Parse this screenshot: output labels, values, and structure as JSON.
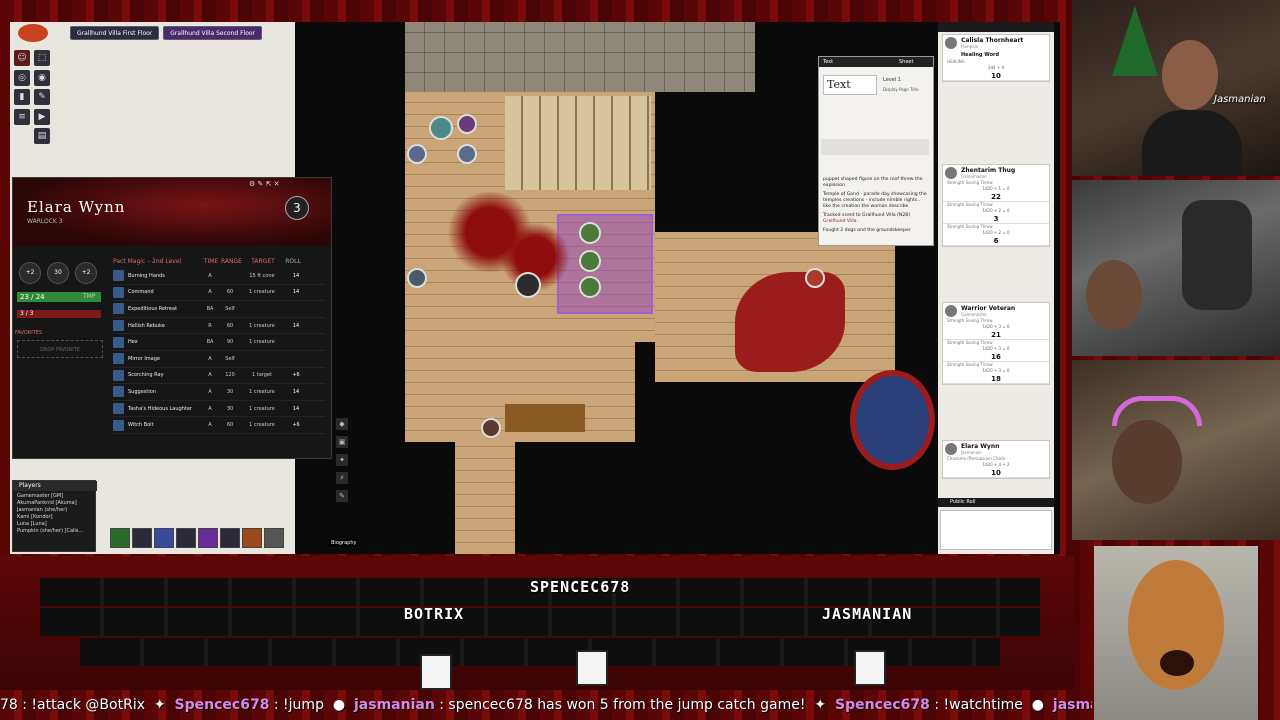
{
  "vtt": {
    "scene_tabs": [
      "Grallhund Villa First Floor",
      "Grallhund Villa Second Floor"
    ],
    "tools": [
      "token",
      "select",
      "measure",
      "light",
      "note",
      "draw",
      "list",
      "play",
      "journal"
    ]
  },
  "character": {
    "name": "Elara Wynn",
    "class": "WARLOCK 3",
    "level": "3",
    "hp": "23 / 24",
    "hp_tmp": "TMP",
    "spell_slots": "3 / 3",
    "favorites_label": "FAVORITES",
    "drop_favorite": "DROP FAVORITE",
    "stats": [
      "+2",
      "30",
      "+2"
    ],
    "spells_header": "Pact Magic – 2nd Level",
    "columns": [
      "TIME",
      "RANGE",
      "TARGET",
      "ROLL"
    ],
    "spells": [
      {
        "name": "Burning Hands",
        "time": "A",
        "range": "",
        "target": "15 ft cone",
        "roll": "14"
      },
      {
        "name": "Command",
        "time": "A",
        "range": "60",
        "target": "1 creature",
        "roll": "14"
      },
      {
        "name": "Expeditious Retreat",
        "time": "BA",
        "range": "Self",
        "target": "",
        "roll": ""
      },
      {
        "name": "Hellish Rebuke",
        "time": "R",
        "range": "60",
        "target": "1 creature",
        "roll": "14"
      },
      {
        "name": "Hex",
        "time": "BA",
        "range": "90",
        "target": "1 creature",
        "roll": ""
      },
      {
        "name": "Mirror Image",
        "time": "A",
        "range": "Self",
        "target": "",
        "roll": ""
      },
      {
        "name": "Scorching Ray",
        "time": "A",
        "range": "120",
        "target": "1 target",
        "roll": "+6"
      },
      {
        "name": "Suggestion",
        "time": "A",
        "range": "30",
        "target": "1 creature",
        "roll": "14"
      },
      {
        "name": "Tasha's Hideous Laughter",
        "time": "A",
        "range": "30",
        "target": "1 creature",
        "roll": "14"
      },
      {
        "name": "Witch Bolt",
        "time": "A",
        "range": "60",
        "target": "1 creature",
        "roll": "+6"
      }
    ],
    "tooltip": "Biography"
  },
  "players": {
    "title": "Players",
    "list": [
      "Gamemaster [GM]",
      "AkumaPanknid [Akuma]",
      "Jasmanian (she/her)",
      "Kami [Kondor]",
      "Luna [Luna]",
      "Pumpkin (she/her) [Calis..."
    ]
  },
  "journal": {
    "tab": "Text",
    "sheet_btn": "Sheet",
    "name": "Text",
    "level": "Level 1",
    "display": "Display Page Title",
    "text": [
      "puppet shaped figure on the roof threw the explosion",
      "Temple of Gond - parade day showcasing the temples creations - include nimble rights.. like the creation the woman describe",
      "Tracked scent to Grallhund Villa (N2B)",
      "Fought 2 dogs and the groundskeeper"
    ],
    "highlight": "Grallhund Villa"
  },
  "rolls": {
    "cards": [
      {
        "name": "Calisla Thornheart",
        "sub": "Pumpkin",
        "spell": "Healing Word",
        "rows": [
          {
            "label": "HEALING",
            "formula": "2d4 + 4",
            "value": "10"
          }
        ]
      },
      {
        "name": "Zhentarim Thug",
        "sub": "Gamemaster",
        "rows": [
          {
            "label": "Strength Saving Throw",
            "formula": "1d20 + 1 = 0",
            "value": "22"
          },
          {
            "label": "Strength Saving Throw",
            "formula": "1d20 + 2 = 0",
            "value": "3"
          },
          {
            "label": "Strength Saving Throw",
            "formula": "1d20 + 2 = 0",
            "value": "6"
          }
        ]
      },
      {
        "name": "Warrior Veteran",
        "sub": "Gamemaster",
        "rows": [
          {
            "label": "Strength Saving Throw",
            "formula": "1d20 + 3 = 0",
            "value": "21"
          },
          {
            "label": "Strength Saving Throw",
            "formula": "1d20 + 3 = 0",
            "value": "16"
          },
          {
            "label": "Strength Saving Throw",
            "formula": "1d20 + 3 = 0",
            "value": "18"
          }
        ]
      },
      {
        "name": "Elara Wynn",
        "sub": "Jasmanian",
        "rows": [
          {
            "label": "Charisma (Persuasion) Check",
            "formula": "1d20 + 4 + 2",
            "value": "10"
          }
        ]
      }
    ],
    "public_roll": "Public Roll"
  },
  "stream": {
    "cam_name": "Jasmanian",
    "viewers": [
      "SPENCEC678",
      "BOTRIX",
      "JASMANIAN"
    ],
    "ticker": [
      {
        "user": "",
        "text": "78 : !attack @BotRix"
      },
      {
        "user": "Spencec678",
        "text": " : !jump"
      },
      {
        "user": "jasmanian",
        "text": " : spencec678 has won 5 from the jump catch game!"
      },
      {
        "user": "Spencec678",
        "text": " : !watchtime"
      },
      {
        "user": "jasmanian",
        "text": " :"
      }
    ]
  }
}
